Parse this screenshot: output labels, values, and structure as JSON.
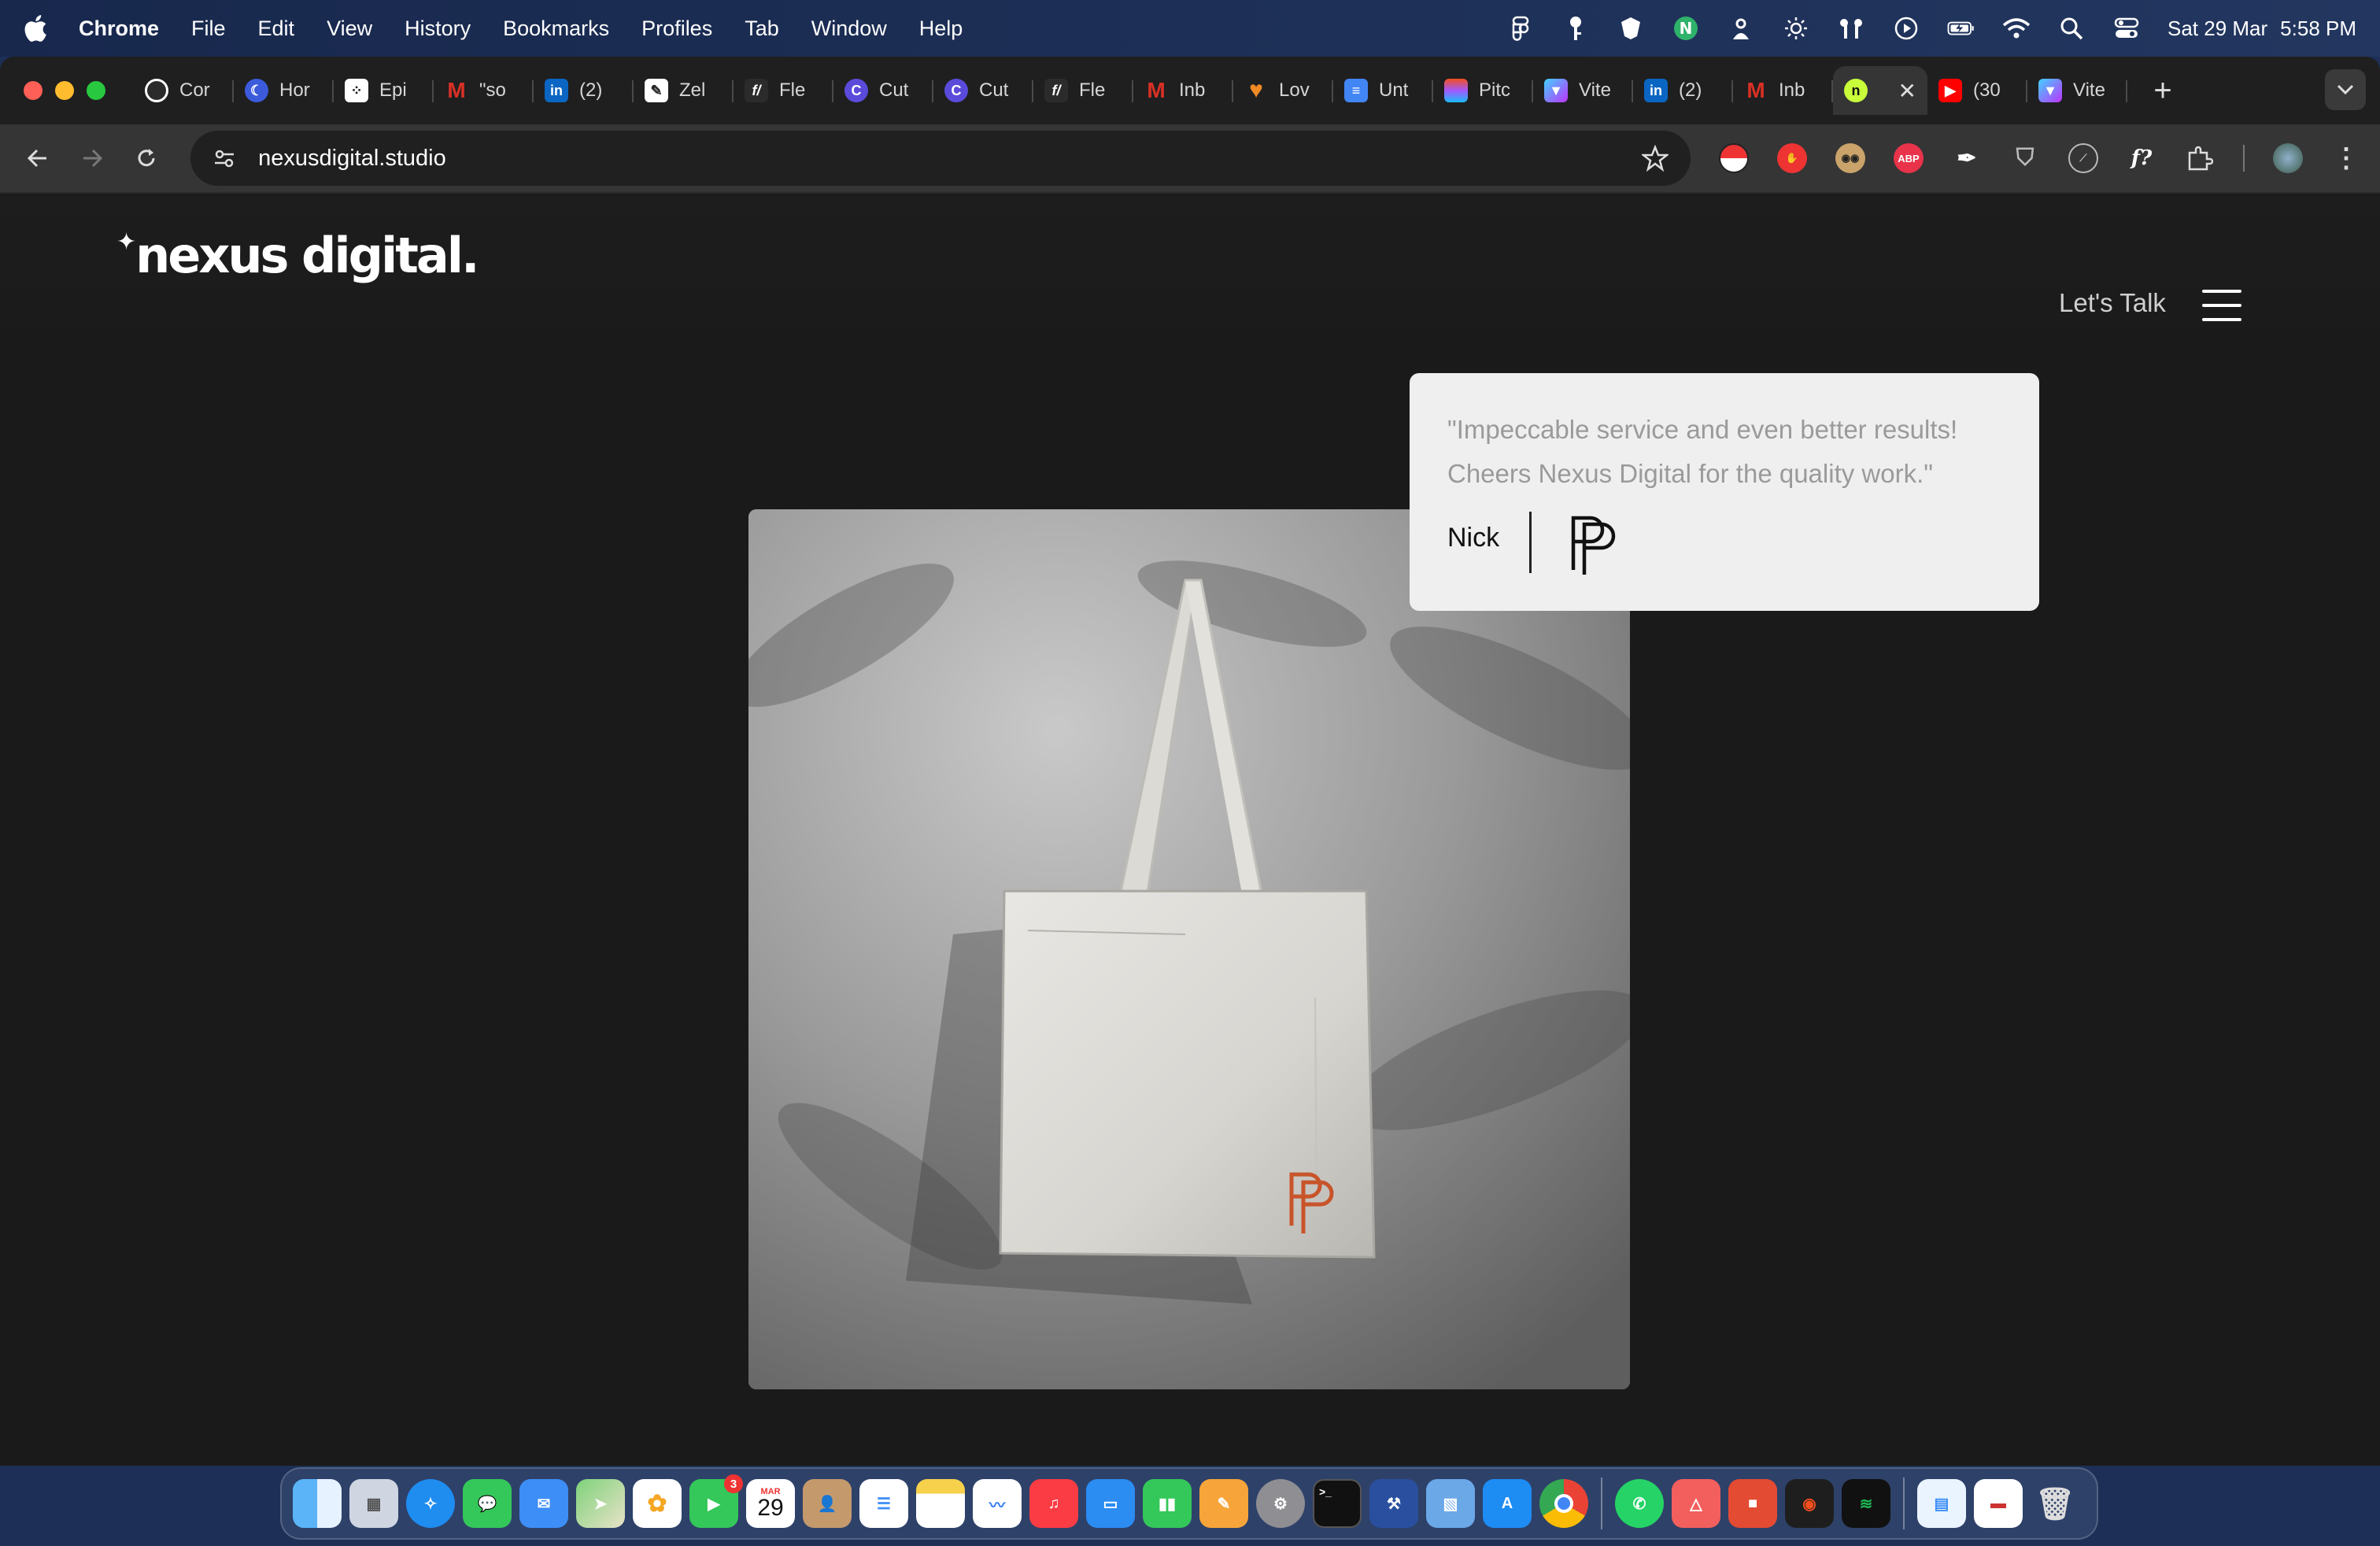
{
  "menubar": {
    "app_name": "Chrome",
    "items": [
      "File",
      "Edit",
      "View",
      "History",
      "Bookmarks",
      "Profiles",
      "Tab",
      "Window",
      "Help"
    ],
    "date": "Sat 29 Mar",
    "time": "5:58 PM"
  },
  "tabs": [
    {
      "label": "Cor",
      "icon": "openai-icon",
      "color": "#2b2b2b"
    },
    {
      "label": "Hor",
      "icon": "bluesky-icon",
      "color": "#3b5bdb"
    },
    {
      "label": "Epi",
      "icon": "dice-icon",
      "color": "#2b2b2b"
    },
    {
      "label": "\"so",
      "icon": "gmail-icon",
      "color": "#d93025"
    },
    {
      "label": "(2)",
      "icon": "linkedin-icon",
      "color": "#0a66c2"
    },
    {
      "label": "Zel",
      "icon": "pen-icon",
      "color": "#555555"
    },
    {
      "label": "Fle",
      "icon": "fx-icon",
      "color": "#2b2b2b"
    },
    {
      "label": "Cut",
      "icon": "cutout-icon",
      "color": "#5b4bdb"
    },
    {
      "label": "Cut",
      "icon": "cutout-icon",
      "color": "#5b4bdb"
    },
    {
      "label": "Fle",
      "icon": "fx-icon",
      "color": "#2b2b2b"
    },
    {
      "label": "Inb",
      "icon": "gmail-icon",
      "color": "#d93025"
    },
    {
      "label": "Lov",
      "icon": "heart-icon",
      "color": "#f08a24"
    },
    {
      "label": "Unt",
      "icon": "docs-icon",
      "color": "#4285f4"
    },
    {
      "label": "Pitc",
      "icon": "figma-icon",
      "color": "#a259ff"
    },
    {
      "label": "Vite",
      "icon": "vite-icon",
      "color": "#8f6cff"
    },
    {
      "label": "(2)",
      "icon": "linkedin-icon",
      "color": "#0a66c2"
    },
    {
      "label": "Inb",
      "icon": "gmail-icon",
      "color": "#d93025"
    },
    {
      "label": "",
      "icon": "nexus-icon",
      "color": "#c8ff3a",
      "active": true
    },
    {
      "label": "(30",
      "icon": "youtube-icon",
      "color": "#ff0000"
    },
    {
      "label": "Vite",
      "icon": "vite-icon",
      "color": "#8f6cff"
    }
  ],
  "toolbar": {
    "url": "nexusdigital.studio"
  },
  "site": {
    "logo_text": "nexus digital.",
    "cta_label": "Let's Talk",
    "testimonial": {
      "quote": "\"Impeccable service and even better results! Cheers Nexus Digital for the quality work.\"",
      "author": "Nick"
    }
  },
  "dock": {
    "facetime_badge": "3",
    "calendar_month": "MAR",
    "calendar_day": "29"
  }
}
